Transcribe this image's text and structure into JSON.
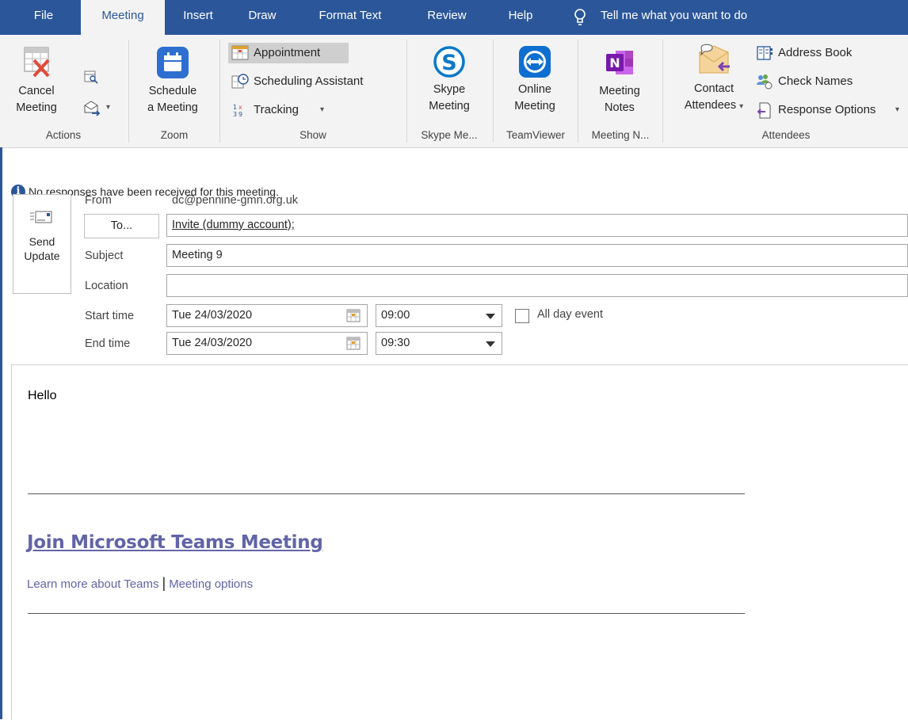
{
  "tabs": [
    {
      "label": "File"
    },
    {
      "label": "Meeting"
    },
    {
      "label": "Insert"
    },
    {
      "label": "Draw"
    },
    {
      "label": "Format Text"
    },
    {
      "label": "Review"
    },
    {
      "label": "Help"
    }
  ],
  "tell_me": "Tell me what you want to do",
  "ribbon": {
    "actions": {
      "cancel_line1": "Cancel",
      "cancel_line2": "Meeting",
      "group": "Actions"
    },
    "zoom": {
      "schedule_line1": "Schedule",
      "schedule_line2": "a Meeting",
      "group": "Zoom"
    },
    "show": {
      "appointment": "Appointment",
      "scheduling": "Scheduling Assistant",
      "tracking": "Tracking",
      "group": "Show"
    },
    "skype": {
      "line1": "Skype",
      "line2": "Meeting",
      "group": "Skype Me..."
    },
    "teamviewer": {
      "line1": "Online",
      "line2": "Meeting",
      "group": "TeamViewer"
    },
    "onenote": {
      "line1": "Meeting",
      "line2": "Notes",
      "group": "Meeting N..."
    },
    "attendees": {
      "contact_line1": "Contact",
      "contact_line2": "Attendees",
      "address_book": "Address Book",
      "check_names": "Check Names",
      "response_options": "Response Options",
      "group": "Attendees"
    }
  },
  "info_message": "No responses have been received for this meeting.",
  "send": {
    "line1": "Send",
    "line2": "Update"
  },
  "form": {
    "from_label": "From",
    "from_value": "dc@pennine-gmn.org.uk",
    "to_button": "To...",
    "to_value": "Invite (dummy account);",
    "subject_label": "Subject",
    "subject_value": "Meeting 9",
    "location_label": "Location",
    "location_value": "",
    "start_label": "Start time",
    "start_date": "Tue 24/03/2020",
    "start_time": "09:00",
    "end_label": "End time",
    "end_date": "Tue 24/03/2020",
    "end_time": "09:30",
    "all_day": "All day event",
    "all_day_checked": false
  },
  "body": {
    "greeting": "Hello",
    "teams_link": "Join Microsoft Teams Meeting",
    "learn_more": "Learn more about Teams",
    "separator": "|",
    "meeting_options": "Meeting options"
  },
  "colors": {
    "accent": "#2b579a",
    "teams": "#6264a7"
  }
}
